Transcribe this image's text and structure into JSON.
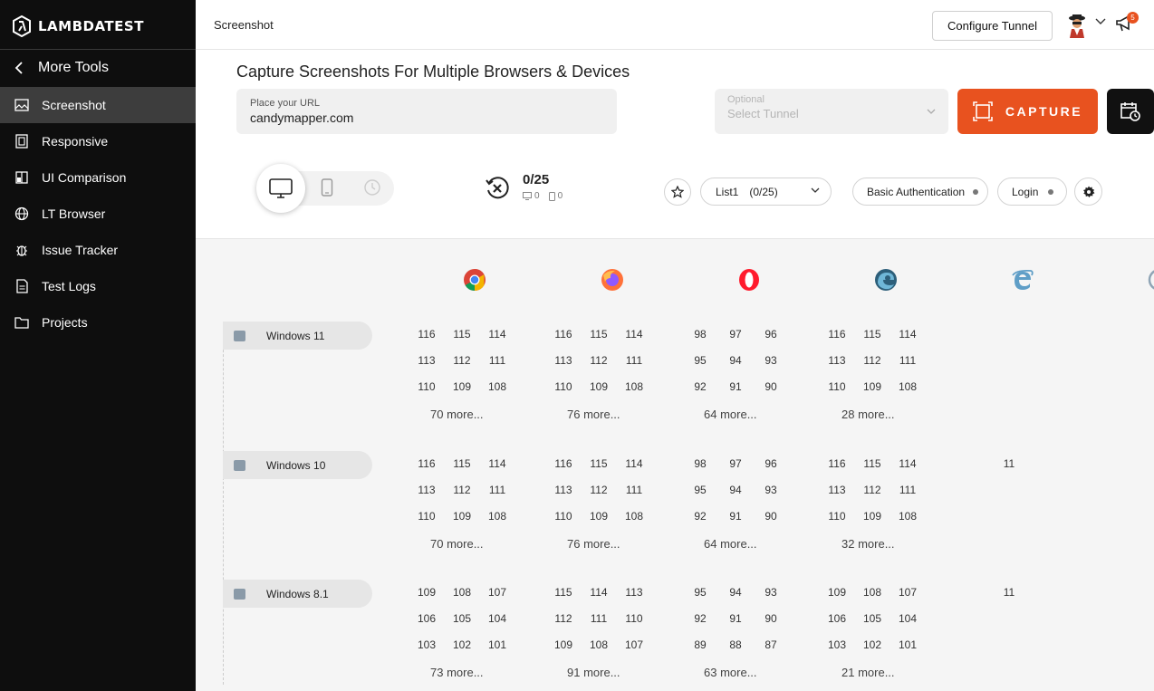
{
  "sidebar": {
    "logo_text": "LAMBDATEST",
    "back_label": "More Tools",
    "items": [
      {
        "label": "Screenshot",
        "icon": "image-icon",
        "active": true
      },
      {
        "label": "Responsive",
        "icon": "responsive-icon",
        "active": false
      },
      {
        "label": "UI Comparison",
        "icon": "compare-icon",
        "active": false
      },
      {
        "label": "LT Browser",
        "icon": "globe-icon",
        "active": false
      },
      {
        "label": "Issue Tracker",
        "icon": "bug-icon",
        "active": false
      },
      {
        "label": "Test Logs",
        "icon": "document-icon",
        "active": false
      },
      {
        "label": "Projects",
        "icon": "folder-icon",
        "active": false
      }
    ]
  },
  "header": {
    "title": "Screenshot",
    "configure_tunnel": "Configure Tunnel",
    "notification_count": "5"
  },
  "main": {
    "heading": "Capture Screenshots For Multiple Browsers & Devices",
    "url_label": "Place your URL",
    "url_value": "candymapper.com",
    "tunnel_optional": "Optional",
    "tunnel_placeholder": "Select Tunnel",
    "capture_label": "CAPTURE",
    "counter": "0/25",
    "counter_desktop": "0",
    "counter_mobile": "0",
    "list_label": "List1",
    "list_count": "(0/25)",
    "basic_auth": "Basic Authentication",
    "login": "Login"
  },
  "browsers": [
    "chrome",
    "firefox",
    "opera",
    "edge",
    "ie",
    "safari"
  ],
  "os_rows": [
    {
      "name": "Windows 11",
      "chrome": [
        "116",
        "115",
        "114",
        "113",
        "112",
        "111",
        "110",
        "109",
        "108"
      ],
      "chrome_more": "70 more...",
      "firefox": [
        "116",
        "115",
        "114",
        "113",
        "112",
        "111",
        "110",
        "109",
        "108"
      ],
      "firefox_more": "76 more...",
      "opera": [
        "98",
        "97",
        "96",
        "95",
        "94",
        "93",
        "92",
        "91",
        "90"
      ],
      "opera_more": "64 more...",
      "edge": [
        "116",
        "115",
        "114",
        "113",
        "112",
        "111",
        "110",
        "109",
        "108"
      ],
      "edge_more": "28 more...",
      "ie": []
    },
    {
      "name": "Windows 10",
      "chrome": [
        "116",
        "115",
        "114",
        "113",
        "112",
        "111",
        "110",
        "109",
        "108"
      ],
      "chrome_more": "70 more...",
      "firefox": [
        "116",
        "115",
        "114",
        "113",
        "112",
        "111",
        "110",
        "109",
        "108"
      ],
      "firefox_more": "76 more...",
      "opera": [
        "98",
        "97",
        "96",
        "95",
        "94",
        "93",
        "92",
        "91",
        "90"
      ],
      "opera_more": "64 more...",
      "edge": [
        "116",
        "115",
        "114",
        "113",
        "112",
        "111",
        "110",
        "109",
        "108"
      ],
      "edge_more": "32 more...",
      "ie": [
        "11"
      ]
    },
    {
      "name": "Windows 8.1",
      "chrome": [
        "109",
        "108",
        "107",
        "106",
        "105",
        "104",
        "103",
        "102",
        "101"
      ],
      "chrome_more": "73 more...",
      "firefox": [
        "115",
        "114",
        "113",
        "112",
        "111",
        "110",
        "109",
        "108",
        "107"
      ],
      "firefox_more": "91 more...",
      "opera": [
        "95",
        "94",
        "93",
        "92",
        "91",
        "90",
        "89",
        "88",
        "87"
      ],
      "opera_more": "63 more...",
      "edge": [
        "109",
        "108",
        "107",
        "106",
        "105",
        "104",
        "103",
        "102",
        "101"
      ],
      "edge_more": "21 more...",
      "ie": [
        "11"
      ]
    }
  ],
  "colors": {
    "accent": "#e8521f",
    "sidebar_bg": "#0e0e0e",
    "sidebar_active": "#3d3d3d"
  }
}
